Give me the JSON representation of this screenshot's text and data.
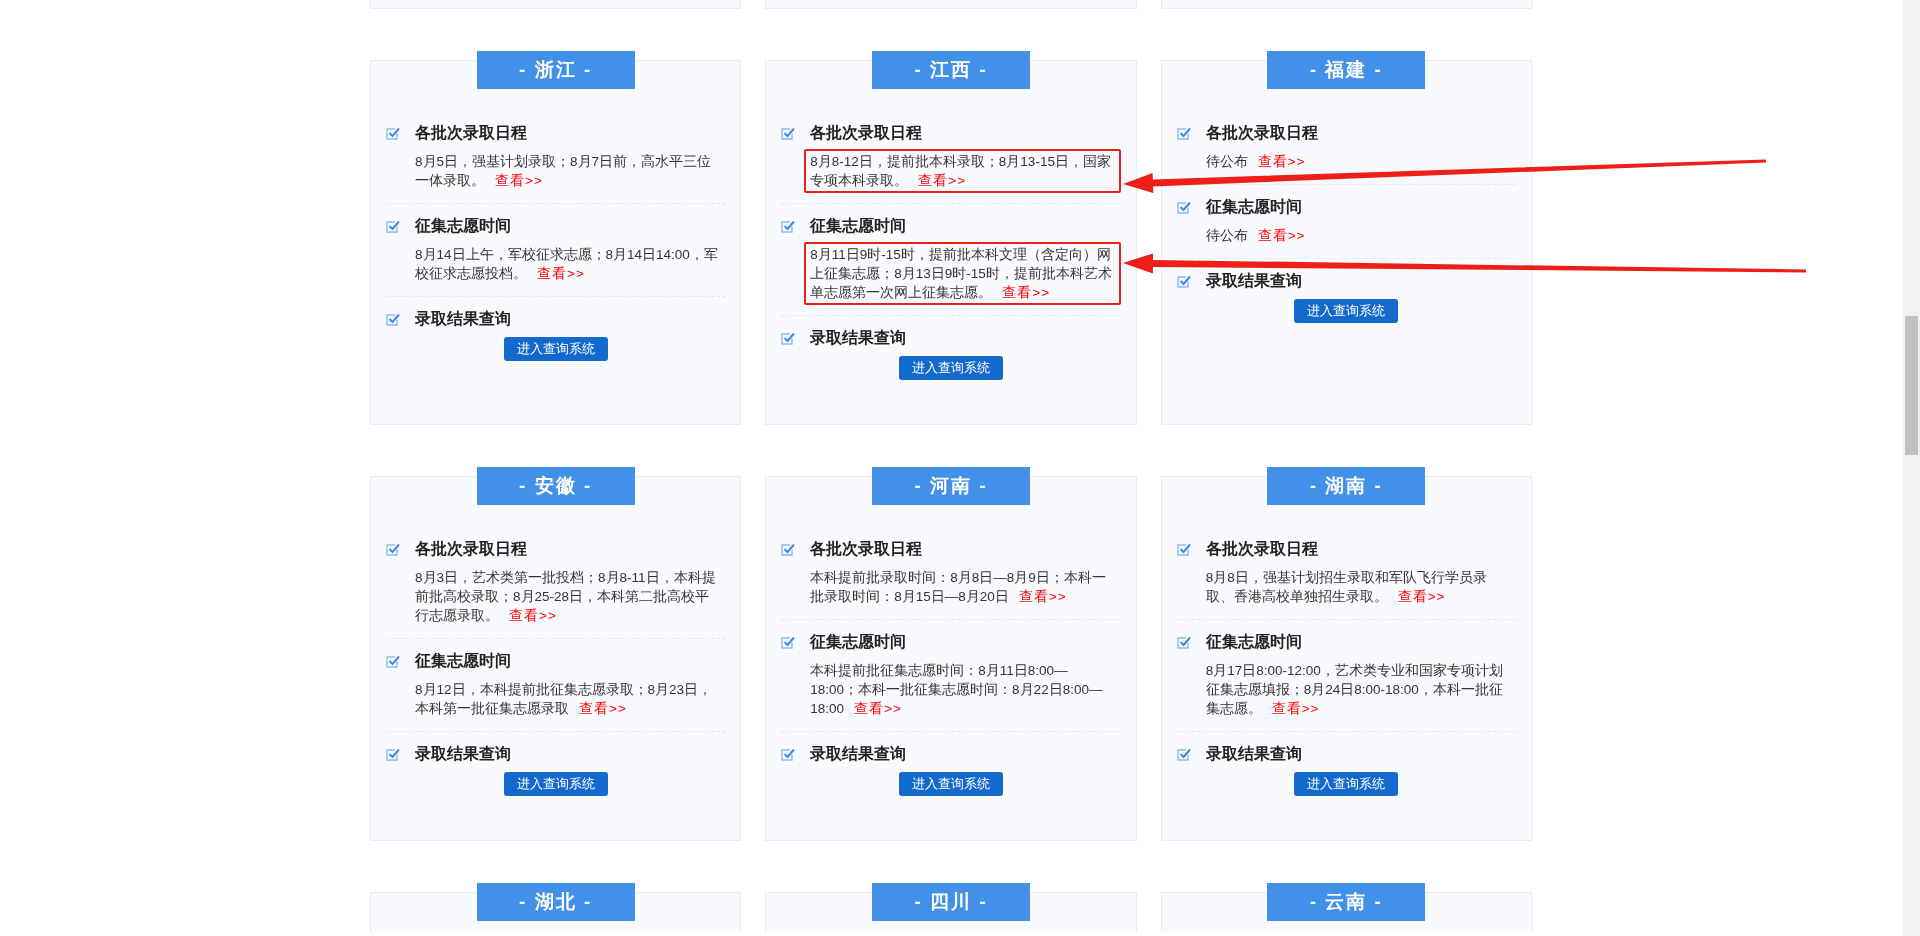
{
  "cards": [
    {
      "title": "- 浙江 -",
      "sections": [
        {
          "kind": "text",
          "heading": "各批次录取日程",
          "text": "8月5日，强基计划录取；8月7日前，高水平三位一体录取。",
          "link": "查看>>",
          "highlighted": false
        },
        {
          "kind": "text",
          "heading": "征集志愿时间",
          "text": "8月14日上午，军校征求志愿；8月14日14:00，军校征求志愿投档。",
          "link": "查看>>",
          "highlighted": false
        },
        {
          "kind": "button",
          "heading": "录取结果查询",
          "button": "进入查询系统"
        }
      ]
    },
    {
      "title": "- 江西 -",
      "sections": [
        {
          "kind": "text",
          "heading": "各批次录取日程",
          "text": "8月8-12日，提前批本科录取；8月13-15日，国家专项本科录取。",
          "link": "查看>>",
          "highlighted": true
        },
        {
          "kind": "text",
          "heading": "征集志愿时间",
          "text": "8月11日9时-15时，提前批本科文理（含定向）网上征集志愿；8月13日9时-15时，提前批本科艺术单志愿第一次网上征集志愿。",
          "link": "查看>>",
          "highlighted": true
        },
        {
          "kind": "button",
          "heading": "录取结果查询",
          "button": "进入查询系统"
        }
      ]
    },
    {
      "title": "- 福建 -",
      "sections": [
        {
          "kind": "text",
          "heading": "各批次录取日程",
          "text": "待公布",
          "link": "查看>>",
          "highlighted": false
        },
        {
          "kind": "text",
          "heading": "征集志愿时间",
          "text": "待公布",
          "link": "查看>>",
          "highlighted": false
        },
        {
          "kind": "button",
          "heading": "录取结果查询",
          "button": "进入查询系统"
        }
      ]
    },
    {
      "title": "- 安徽 -",
      "sections": [
        {
          "kind": "text",
          "heading": "各批次录取日程",
          "text": "8月3日，艺术类第一批投档；8月8-11日，本科提前批高校录取；8月25-28日，本科第二批高校平行志愿录取。",
          "link": "查看>>",
          "highlighted": false
        },
        {
          "kind": "text",
          "heading": "征集志愿时间",
          "text": "8月12日，本科提前批征集志愿录取；8月23日，本科第一批征集志愿录取",
          "link": "查看>>",
          "highlighted": false
        },
        {
          "kind": "button",
          "heading": "录取结果查询",
          "button": "进入查询系统"
        }
      ]
    },
    {
      "title": "- 河南 -",
      "sections": [
        {
          "kind": "text",
          "heading": "各批次录取日程",
          "text": "本科提前批录取时间：8月8日—8月9日；本科一批录取时间：8月15日—8月20日",
          "link": "查看>>",
          "highlighted": false
        },
        {
          "kind": "text",
          "heading": "征集志愿时间",
          "text": "本科提前批征集志愿时间：8月11日8:00—18:00；本科一批征集志愿时间：8月22日8:00—18:00",
          "link": "查看>>",
          "highlighted": false
        },
        {
          "kind": "button",
          "heading": "录取结果查询",
          "button": "进入查询系统"
        }
      ]
    },
    {
      "title": "- 湖南 -",
      "sections": [
        {
          "kind": "text",
          "heading": "各批次录取日程",
          "text": "8月8日，强基计划招生录取和军队飞行学员录取、香港高校单独招生录取。",
          "link": "查看>>",
          "highlighted": false
        },
        {
          "kind": "text",
          "heading": "征集志愿时间",
          "text": "8月17日8:00-12:00，艺术类专业和国家专项计划征集志愿填报；8月24日8:00-18:00，本科一批征集志愿。",
          "link": "查看>>",
          "highlighted": false
        },
        {
          "kind": "button",
          "heading": "录取结果查询",
          "button": "进入查询系统"
        }
      ]
    },
    {
      "title": "- 湖北 -"
    },
    {
      "title": "- 四川 -"
    },
    {
      "title": "- 云南 -"
    }
  ]
}
